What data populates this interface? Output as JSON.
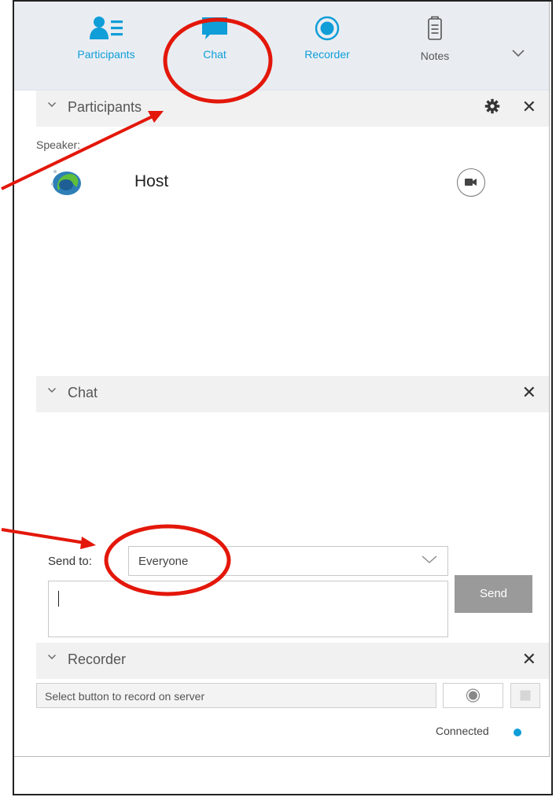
{
  "toolbar": {
    "items": [
      {
        "label": "Participants",
        "icon": "participants-icon"
      },
      {
        "label": "Chat",
        "icon": "chat-icon"
      },
      {
        "label": "Recorder",
        "icon": "recorder-icon"
      },
      {
        "label": "Notes",
        "icon": "notes-icon"
      }
    ],
    "more_icon": "chevron-down-icon"
  },
  "participants": {
    "title": "Participants",
    "speaker_label": "Speaker:",
    "host": {
      "name": "Host"
    }
  },
  "chat": {
    "title": "Chat",
    "send_to_label": "Send to:",
    "send_to_value": "Everyone",
    "message_value": "",
    "send_label": "Send"
  },
  "recorder": {
    "title": "Recorder",
    "hint": "Select button to record on server",
    "status": "Connected"
  },
  "colors": {
    "accent": "#0f9ed8",
    "annotation": "#e3170a",
    "toolbar_bg": "#e9edf2"
  }
}
